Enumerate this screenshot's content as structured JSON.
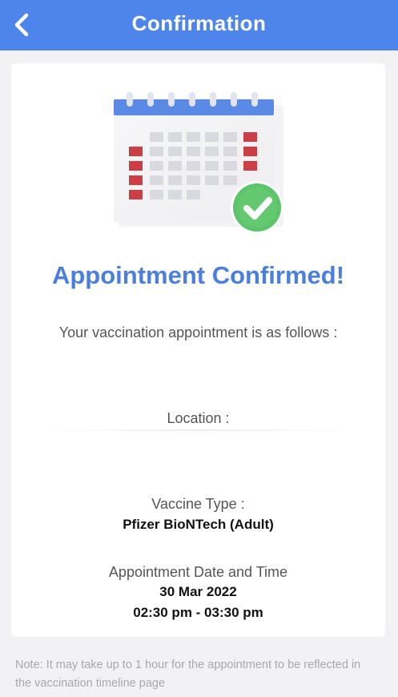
{
  "header": {
    "title": "Confirmation",
    "back_icon": "chevron-left-icon",
    "color": "#4e85ea"
  },
  "card": {
    "illustration_icon": "calendar-check-icon",
    "title": "Appointment Confirmed!",
    "subtitle": "Your vaccination appointment is as follows :",
    "location_label": "Location :",
    "vaccine_label": "Vaccine Type :",
    "vaccine_value": "Pfizer BioNTech (Adult)",
    "datetime_label": "Appointment Date and Time",
    "date_value": "30 Mar 2022",
    "time_value": "02:30 pm - 03:30 pm"
  },
  "note": "Note: It may take up to 1 hour for the appointment to be reflected in the vaccination timeline page",
  "colors": {
    "accent": "#4b7fde",
    "calendar_red": "#cc3d44",
    "check_green": "#5cc46a"
  }
}
